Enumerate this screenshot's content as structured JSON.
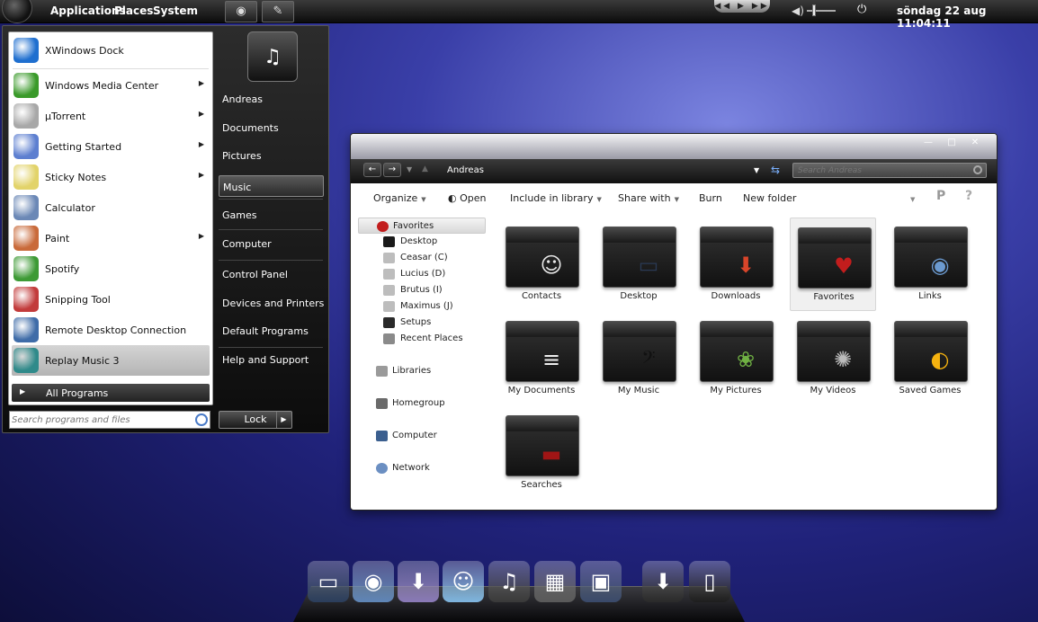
{
  "top_panel": {
    "menus": [
      "Applications",
      "Places",
      "System"
    ],
    "clock": "söndag 22 aug   11:04:11",
    "media_controls": "◀◀ ▶ ▶▶",
    "icons": [
      "gnome-foot-icon",
      "launcher-firefox-icon",
      "launcher-tool-icon",
      "volume-icon",
      "power-icon"
    ]
  },
  "start_menu": {
    "programs": [
      {
        "label": "XWindows Dock",
        "icon": "xwindows-dock-icon",
        "color": "#1f6fcf",
        "arrow": false
      },
      {
        "label": "Windows Media Center",
        "icon": "windows-media-center-icon",
        "color": "#3a9a2a",
        "arrow": true
      },
      {
        "label": "µTorrent",
        "icon": "utorrent-icon",
        "color": "#a8a8a8",
        "arrow": true
      },
      {
        "label": "Getting Started",
        "icon": "getting-started-icon",
        "color": "#5d7fd0",
        "arrow": true
      },
      {
        "label": "Sticky Notes",
        "icon": "sticky-notes-icon",
        "color": "#e2d36a",
        "arrow": true
      },
      {
        "label": "Calculator",
        "icon": "calculator-icon",
        "color": "#6b88b6",
        "arrow": false
      },
      {
        "label": "Paint",
        "icon": "paint-icon",
        "color": "#c96a3a",
        "arrow": true
      },
      {
        "label": "Spotify",
        "icon": "spotify-icon",
        "color": "#3d9a35",
        "arrow": false
      },
      {
        "label": "Snipping Tool",
        "icon": "snipping-tool-icon",
        "color": "#c23b3b",
        "arrow": false
      },
      {
        "label": "Remote Desktop Connection",
        "icon": "remote-desktop-icon",
        "color": "#3f6ca8",
        "arrow": false
      },
      {
        "label": "Replay Music 3",
        "icon": "replay-music-icon",
        "color": "#2f8a8a",
        "arrow": false,
        "selected": true
      }
    ],
    "all_programs": "All Programs",
    "search_placeholder": "Search programs and files",
    "places": [
      {
        "label": "Andreas"
      },
      {
        "label": "Documents"
      },
      {
        "label": "Pictures"
      },
      {
        "label": "Music",
        "selected": true
      },
      {
        "label": "Games"
      },
      {
        "label": "Computer"
      },
      {
        "label": "Control Panel"
      },
      {
        "label": "Devices and Printers"
      },
      {
        "label": "Default Programs"
      },
      {
        "label": "Help and Support"
      }
    ],
    "lock_label": "Lock"
  },
  "explorer": {
    "window_buttons": {
      "minimize": "—",
      "maximize": "□",
      "close": "✕"
    },
    "address_path": "Andreas",
    "search_placeholder": "Search Andreas",
    "toolbar": {
      "organize": "Organize",
      "open": "Open",
      "include_in_library": "Include in library",
      "share_with": "Share with",
      "burn": "Burn",
      "new_folder": "New folder"
    },
    "nav": {
      "favorites": "Favorites",
      "favorites_children": [
        "Desktop",
        "Ceasar (C)",
        "Lucius (D)",
        "Brutus (I)",
        "Maximus (J)",
        "Setups",
        "Recent Places"
      ],
      "libraries": "Libraries",
      "homegroup": "Homegroup",
      "computer": "Computer",
      "network": "Network"
    },
    "folders": [
      {
        "label": "Contacts",
        "emblem": "contacts-icon",
        "emblem_color": "#e8e8e8",
        "glyph": "☺"
      },
      {
        "label": "Desktop",
        "emblem": "desktop-monitor-icon",
        "emblem_color": "#2a3a55",
        "glyph": "▭"
      },
      {
        "label": "Downloads",
        "emblem": "download-arrow-icon",
        "emblem_color": "#d8452a",
        "glyph": "⬇"
      },
      {
        "label": "Favorites",
        "emblem": "heart-icon",
        "emblem_color": "#c21d1d",
        "glyph": "♥",
        "selected": true
      },
      {
        "label": "Links",
        "emblem": "globe-icon",
        "emblem_color": "#6b9ad0",
        "glyph": "◉"
      },
      {
        "label": "My Documents",
        "emblem": "document-icon",
        "emblem_color": "#eeeeee",
        "glyph": "≡"
      },
      {
        "label": "My Music",
        "emblem": "bass-clef-icon",
        "emblem_color": "#111111",
        "glyph": "𝄢"
      },
      {
        "label": "My Pictures",
        "emblem": "photo-icon",
        "emblem_color": "#6fb043",
        "glyph": "❀"
      },
      {
        "label": "My Videos",
        "emblem": "film-reel-icon",
        "emblem_color": "#bbbbbb",
        "glyph": "✺"
      },
      {
        "label": "Saved Games",
        "emblem": "pacman-icon",
        "emblem_color": "#f5b20f",
        "glyph": "◐"
      },
      {
        "label": "Searches",
        "emblem": "search-bar-icon",
        "emblem_color": "#a01515",
        "glyph": "▬"
      }
    ]
  },
  "dock": {
    "icons": [
      {
        "name": "monitor-icon",
        "glyph": "▭",
        "color": "#2b3e5c"
      },
      {
        "name": "globe-icon",
        "glyph": "◉",
        "color": "#5f86b8"
      },
      {
        "name": "download-icon",
        "glyph": "⬇",
        "color": "#8a7ab8"
      },
      {
        "name": "chat-icon",
        "glyph": "☺",
        "color": "#7fb6e0"
      },
      {
        "name": "music-disc-icon",
        "glyph": "♫",
        "color": "#3a3a3a"
      },
      {
        "name": "photos-icon",
        "glyph": "▦",
        "color": "#5a5a5a"
      },
      {
        "name": "video-icon",
        "glyph": "▣",
        "color": "#3a4a6a"
      },
      {
        "name": "downloads-folder-icon",
        "glyph": "⬇",
        "color": "#2a2a2a"
      },
      {
        "name": "trash-icon",
        "glyph": "▯",
        "color": "#1e1e1e"
      }
    ]
  }
}
